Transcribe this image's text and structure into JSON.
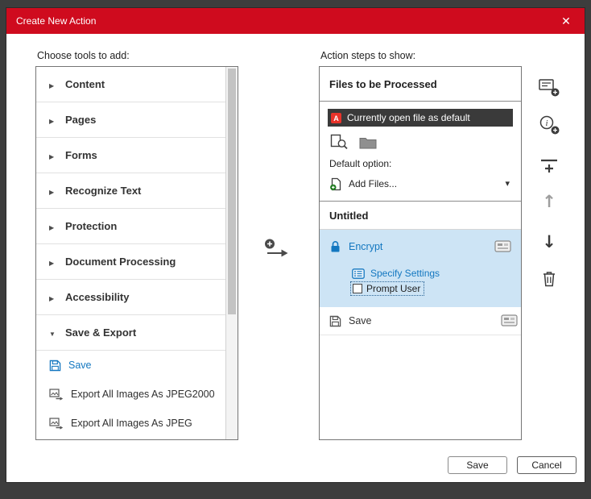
{
  "window": {
    "title": "Create New Action"
  },
  "icons": {
    "close": "✕",
    "collapsed": "",
    "expanded": "",
    "dropdown": "▾",
    "up_arrow": "↑",
    "down_arrow": "↓"
  },
  "left_panel": {
    "label": "Choose tools to add:",
    "categories": [
      {
        "label": "Content",
        "expanded": false
      },
      {
        "label": "Pages",
        "expanded": false
      },
      {
        "label": "Forms",
        "expanded": false
      },
      {
        "label": "Recognize Text",
        "expanded": false
      },
      {
        "label": "Protection",
        "expanded": false
      },
      {
        "label": "Document Processing",
        "expanded": false
      },
      {
        "label": "Accessibility",
        "expanded": false
      },
      {
        "label": "Save & Export",
        "expanded": true
      }
    ],
    "tools": [
      {
        "label": "Save"
      },
      {
        "label": "Export All Images As JPEG2000"
      },
      {
        "label": "Export All Images As JPEG"
      }
    ]
  },
  "right_panel": {
    "label": "Action steps to show:",
    "files_header": "Files to be Processed",
    "current_file": "Currently open file as default",
    "default_option_label": "Default option:",
    "add_files": "Add Files...",
    "untitled_label": "Untitled",
    "encrypt_step": {
      "label": "Encrypt",
      "settings_link": "Specify Settings",
      "prompt_label": "Prompt User",
      "prompt_checked": false
    },
    "save_step": {
      "label": "Save"
    }
  },
  "footer": {
    "save": "Save",
    "cancel": "Cancel"
  },
  "colors": {
    "titlebar_red": "#cf0b1e",
    "accent_blue": "#1377c0",
    "selected_step_blue": "#cde4f5",
    "selected_file_dark": "#3a3a3a"
  }
}
